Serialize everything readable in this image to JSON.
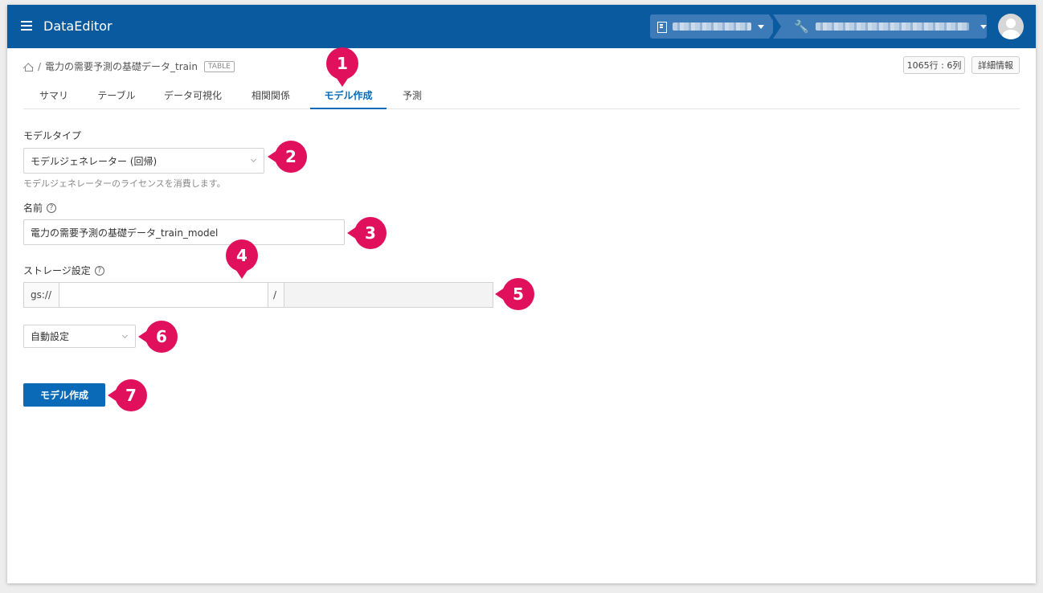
{
  "header": {
    "app_title": "DataEditor",
    "org_selector": "",
    "project_selector": ""
  },
  "breadcrumb": {
    "separator": "/",
    "table_name": "電力の需要予測の基礎データ_train",
    "badge": "TABLE"
  },
  "toolbar": {
    "rows_cols": "1065行 : 6列",
    "details": "詳細情報"
  },
  "tabs": [
    {
      "label": "サマリ"
    },
    {
      "label": "テーブル"
    },
    {
      "label": "データ可視化"
    },
    {
      "label": "相関関係"
    },
    {
      "label": "モデル作成"
    },
    {
      "label": "予測"
    }
  ],
  "form": {
    "model_type_label": "モデルタイプ",
    "model_type_value": "モデルジェネレーター (回帰)",
    "model_type_hint": "モデルジェネレーターのライセンスを消費します。",
    "name_label": "名前",
    "name_value": "電力の需要予測の基礎データ_train_model",
    "storage_label": "ストレージ設定",
    "storage_prefix": "gs://",
    "storage_bucket": "",
    "storage_sep": "/",
    "storage_path": "",
    "storage_mode": "自動設定",
    "submit_label": "モデル作成"
  },
  "markers": [
    "1",
    "2",
    "3",
    "4",
    "5",
    "6",
    "7"
  ],
  "colors": {
    "header_bg": "#0a5aa0",
    "accent": "#0a6ab8",
    "marker": "#e0105c"
  }
}
